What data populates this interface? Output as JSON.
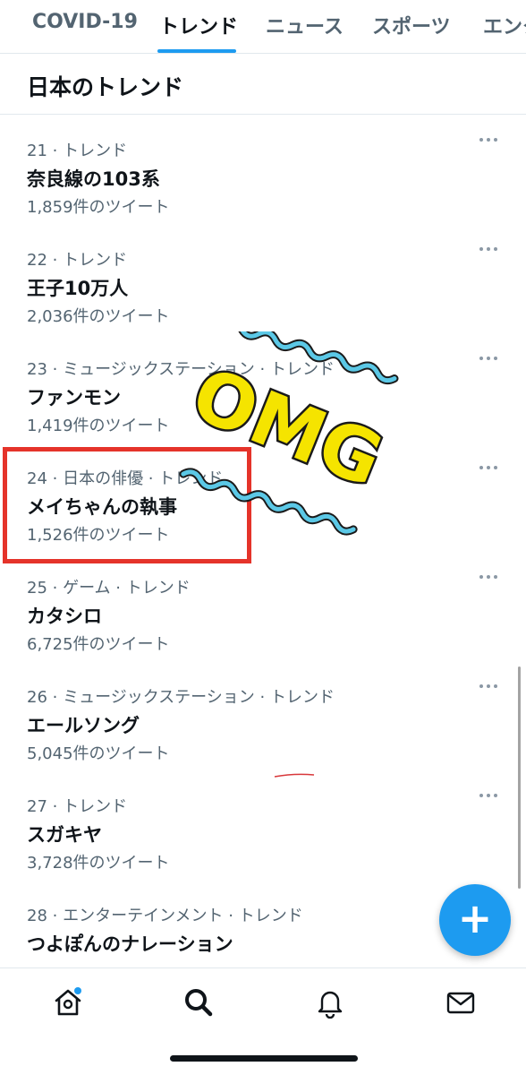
{
  "tabs": [
    {
      "label": "COVID-19"
    },
    {
      "label": "トレンド"
    },
    {
      "label": "ニュース"
    },
    {
      "label": "スポーツ"
    },
    {
      "label": "エンタ"
    }
  ],
  "active_tab_index": 1,
  "section": {
    "title": "日本のトレンド"
  },
  "trends": [
    {
      "meta": "21 · トレンド",
      "name": "奈良線の103系",
      "count": "1,859件のツイート"
    },
    {
      "meta": "22 · トレンド",
      "name": "王子10万人",
      "count": "2,036件のツイート"
    },
    {
      "meta": "23 · ミュージックステーション · トレンド",
      "name": "ファンモン",
      "count": "1,419件のツイート"
    },
    {
      "meta": "24 · 日本の俳優 · トレンド",
      "name": "メイちゃんの執事",
      "count": "1,526件のツイート"
    },
    {
      "meta": "25 · ゲーム · トレンド",
      "name": "カタシロ",
      "count": "6,725件のツイート"
    },
    {
      "meta": "26 · ミュージックステーション · トレンド",
      "name": "エールソング",
      "count": "5,045件のツイート"
    },
    {
      "meta": "27 · トレンド",
      "name": "スガキヤ",
      "count": "3,728件のツイート"
    },
    {
      "meta": "28 · エンターテインメント · トレンド",
      "name": "つよぽんのナレーション",
      "count": ""
    }
  ],
  "sticker": {
    "text": "OMG"
  },
  "fab": {
    "label": "+"
  },
  "bottom_nav": {
    "items": [
      {
        "icon": "home-icon",
        "has_notification_dot": true
      },
      {
        "icon": "search-icon"
      },
      {
        "icon": "bell-icon"
      },
      {
        "icon": "mail-icon"
      }
    ]
  },
  "colors": {
    "accent": "#1d9bf0",
    "text_primary": "#0f1419",
    "text_secondary": "#536471",
    "highlight": "#e5332a",
    "sticker_fill": "#f5e400",
    "sticker_wave": "#5bc8e6"
  }
}
